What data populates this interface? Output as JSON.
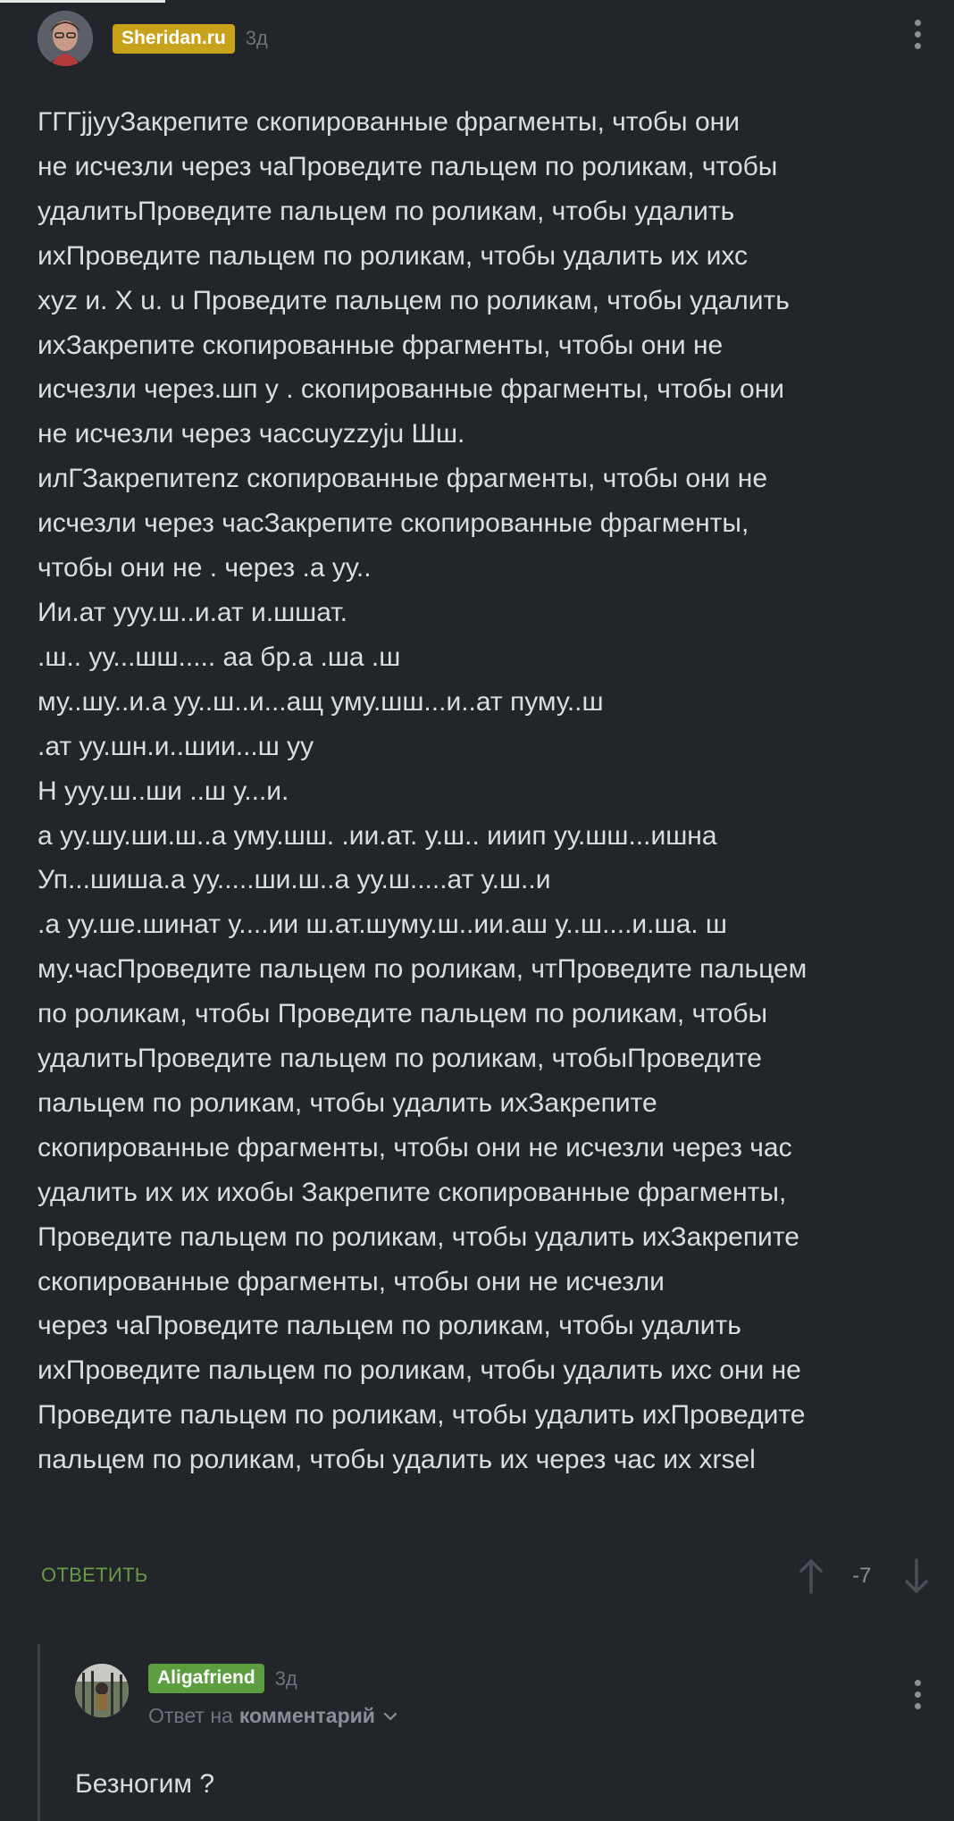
{
  "colors": {
    "background": "#22252a",
    "text": "#dcdde0",
    "muted": "#6f747b",
    "author_badge": "#c9a21c",
    "reply_badge": "#5c9e3f",
    "reply_link": "#6a9a45"
  },
  "comment": {
    "author": "Sheridan.ru",
    "time": "3д",
    "avatar_icon": "avatar",
    "menu_icon": "kebab-menu-icon",
    "body": "ГГГjjyyЗакрепите скопированные фрагменты, чтобы они\nне исчезли через чаПроведите пальцем по роликам, чтобы\nудалитьПроведите пальцем по роликам, чтобы удалить\nихПроведите пальцем по роликам, чтобы удалить их ихс\nxyz и. X u. u Проведите пальцем по роликам, чтобы удалить\nихЗакрепите скопированные фрагменты, чтобы они не\nисчезли через.шп у . скопированные фрагменты, чтобы они\nне исчезли через часcuyzzyju Шш.\nилГЗакрепитеnz скопированные фрагменты, чтобы они не\nисчезли через часЗакрепите скопированные фрагменты,\nчтобы они не . через .а уу..\nИи.ат ууу.ш..и.ат и.шшат.\n.ш.. уу...шш..... аа бр.а .ша .ш\nму..шу..и.а уу..ш..и...ащ уму.шш...и..ат пуму..ш\n.ат уу.шн.и..шии...ш уу\nН ууу.ш..ши ..ш у...и.\nа уу.шу.ши.ш..а уму.шш. .ии.ат. у.ш.. ииип уу.шш...ишна\n Уп...шиша.а уу.....ши.ш..а уу.ш.....ат у.ш..и\n.а уу.ше.шинат у....ии ш.ат.шуму.ш..ии.аш у..ш....и.ша. ш\nму.часПроведите пальцем по роликам, чтПроведите пальцем\nпо роликам, чтобы Проведите пальцем по роликам, чтобы\nудалитьПроведите пальцем по роликам, чтобыПроведите\nпальцем по роликам, чтобы удалить ихЗакрепите\nскопированные фрагменты, чтобы они не исчезли через час\nудалить их их ихобы Закрепите скопированные фрагменты,\nПроведите пальцем по роликам, чтобы удалить ихЗакрепите\nскопированные фрагменты, чтобы они не исчезли\nчерез чаПроведите пальцем по роликам, чтобы удалить\nихПроведите пальцем по роликам, чтобы удалить ихс они не\nПроведите пальцем по роликам, чтобы удалить ихПроведите\nпальцем по роликам, чтобы удалить их через час их xrsel",
    "reply_label": "ОТВЕТИТЬ",
    "rating": "-7",
    "upvote_icon": "arrow-up-icon",
    "downvote_icon": "arrow-down-icon"
  },
  "reply": {
    "author": "Aligafriend",
    "time": "3д",
    "reply_to_prefix": "Ответ на",
    "reply_to_target": "комментарий",
    "body": "Безногим ?",
    "menu_icon": "kebab-menu-icon",
    "expand_icon": "chevron-down-icon"
  }
}
